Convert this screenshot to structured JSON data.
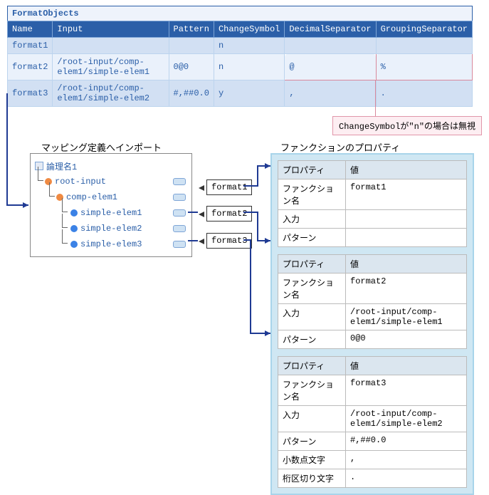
{
  "formatObjects": {
    "title": "FormatObjects",
    "cols": {
      "name": "Name",
      "input": "Input",
      "pattern": "Pattern",
      "change": "ChangeSymbol",
      "dec": "DecimalSeparator",
      "grp": "GroupingSeparator"
    },
    "rows": [
      {
        "name": "format1",
        "input": "",
        "pattern": "",
        "change": "n",
        "dec": "",
        "grp": ""
      },
      {
        "name": "format2",
        "input": "/root-input/comp-elem1/simple-elem1",
        "pattern": "0@0",
        "change": "n",
        "dec": "@",
        "grp": "%"
      },
      {
        "name": "format3",
        "input": "/root-input/comp-elem1/simple-elem2",
        "pattern": "#,##0.0",
        "change": "y",
        "dec": ",",
        "grp": "."
      }
    ]
  },
  "callout": "ChangeSymbolが\"n\"の場合は無視",
  "labels": {
    "mapping": "マッピング定義へインポート",
    "func": "ファンクションのプロパティ"
  },
  "tree": {
    "root": "論理名1",
    "n1": "root-input",
    "n2": "comp-elem1",
    "n3": "simple-elem1",
    "n4": "simple-elem2",
    "n5": "simple-elem3"
  },
  "fbox": {
    "f1": "format1",
    "f2": "format2",
    "f3": "format3"
  },
  "propHeaders": {
    "prop": "プロパティ",
    "val": "値"
  },
  "propLabels": {
    "fname": "ファンクション名",
    "input": "入力",
    "pattern": "パターン",
    "decchar": "小数点文字",
    "grpchar": "桁区切り文字"
  },
  "p1": {
    "fname": "format1",
    "input": "",
    "pattern": ""
  },
  "p2": {
    "fname": "format2",
    "input": "/root-input/comp-elem1/simple-elem1",
    "pattern": "0@0"
  },
  "p3": {
    "fname": "format3",
    "input": "/root-input/comp-elem1/simple-elem2",
    "pattern": "#,##0.0",
    "dec": ",",
    "grp": "."
  }
}
